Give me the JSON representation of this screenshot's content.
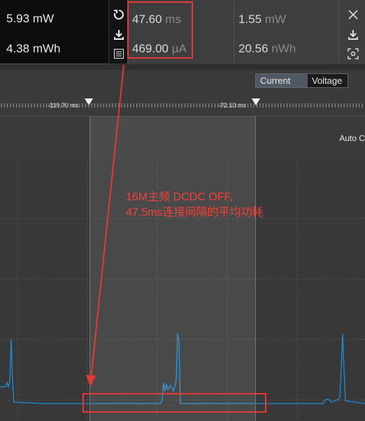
{
  "stats_left": {
    "power": {
      "value": "5.93",
      "unit": "mW"
    },
    "energy": {
      "value": "4.38",
      "unit": "mWh"
    }
  },
  "stats_mid": {
    "duration": {
      "value": "47.60",
      "unit": "ms"
    },
    "current": {
      "value": "469.00",
      "unit": "µA"
    }
  },
  "stats_right": {
    "power": {
      "value": "1.55",
      "unit": "mW"
    },
    "energy": {
      "value": "20.56",
      "unit": "nWh"
    }
  },
  "toggle": {
    "current_label": "Current",
    "voltage_label": "Voltage",
    "selected": "Current"
  },
  "markers": {
    "left": "-119.70 ms",
    "right": "-72.10 ms"
  },
  "chart": {
    "auto_label": "Auto C"
  },
  "annotation": {
    "line1": "16M主频 DCDC OFF,",
    "line2": "47.5ms连接间隔的平均功耗"
  },
  "colors": {
    "trace": "#1e8fd6",
    "highlight": "#e53935",
    "grid": "#6a6a6a"
  }
}
